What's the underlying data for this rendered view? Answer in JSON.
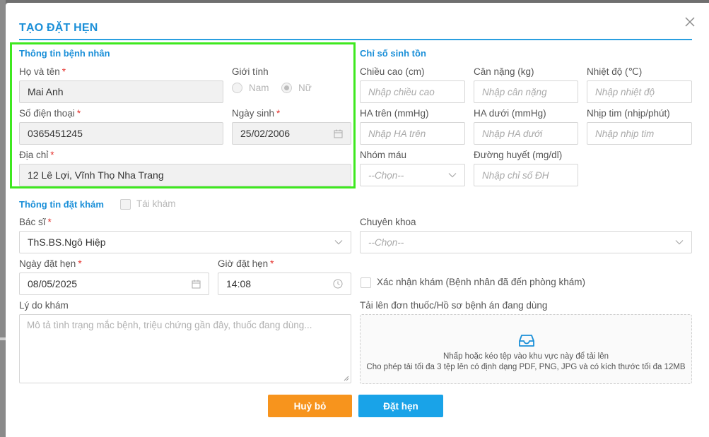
{
  "modal": {
    "title": "TẠO ĐẶT HẸN"
  },
  "patient": {
    "section_title": "Thông tin bệnh nhân",
    "name_label": "Họ và tên",
    "name_value": "Mai Anh",
    "gender_label": "Giới tính",
    "gender_options": [
      "Nam",
      "Nữ"
    ],
    "gender_selected": "Nữ",
    "phone_label": "Số điện thoại",
    "phone_value": "0365451245",
    "dob_label": "Ngày sinh",
    "dob_value": "25/02/2006",
    "address_label": "Địa chỉ",
    "address_value": "12 Lê Lợi, Vĩnh Thọ Nha Trang",
    "required_mark": "*"
  },
  "vitals": {
    "section_title": "Chỉ số sinh tồn",
    "height_label": "Chiều cao (cm)",
    "height_placeholder": "Nhập chiều cao",
    "weight_label": "Cân nặng (kg)",
    "weight_placeholder": "Nhập cân nặng",
    "temp_label": "Nhiệt độ (℃)",
    "temp_placeholder": "Nhập nhiệt độ",
    "bp_high_label": "HA trên (mmHg)",
    "bp_high_placeholder": "Nhập HA trên",
    "bp_low_label": "HA dưới (mmHg)",
    "bp_low_placeholder": "Nhập HA dưới",
    "pulse_label": "Nhịp tim (nhịp/phút)",
    "pulse_placeholder": "Nhập nhịp tim",
    "blood_type_label": "Nhóm máu",
    "blood_type_value": "--Chọn--",
    "glucose_label": "Đường huyết (mg/dl)",
    "glucose_placeholder": "Nhập chỉ số ĐH"
  },
  "booking": {
    "section_title": "Thông tin đặt khám",
    "revisit_label": "Tái khám",
    "doctor_label": "Bác sĩ",
    "doctor_value": "ThS.BS.Ngô Hiệp",
    "specialty_label": "Chuyên khoa",
    "specialty_value": "--Chọn--",
    "date_label": "Ngày đặt hẹn",
    "date_value": "08/05/2025",
    "time_label": "Giờ đặt hẹn",
    "time_value": "14:08",
    "confirm_label": "Xác nhận khám (Bệnh nhân đã đến phòng khám)",
    "reason_label": "Lý do khám",
    "reason_placeholder": "Mô tả tình trạng mắc bệnh, triệu chứng gần đây, thuốc đang dùng...",
    "upload_label": "Tải lên đơn thuốc/Hồ sơ bệnh án đang dùng",
    "upload_hint": "Nhấp hoặc kéo tệp vào khu vực này để tải lên",
    "upload_limits": "Cho phép tải tối đa 3 tệp lên có định dạng PDF, PNG, JPG và có kích thước tối đa 12MB"
  },
  "actions": {
    "cancel_label": "Huỷ bỏ",
    "submit_label": "Đặt hẹn"
  },
  "colors": {
    "accent": "#1a8fd8",
    "cancel": "#f7941d",
    "submit": "#19a3e8",
    "highlight": "#3ee81f",
    "required": "#e5322d"
  },
  "icons": {
    "close": "close-icon",
    "calendar": "calendar-icon",
    "clock": "clock-icon",
    "chevron": "chevron-down-icon",
    "inbox": "inbox-icon"
  }
}
